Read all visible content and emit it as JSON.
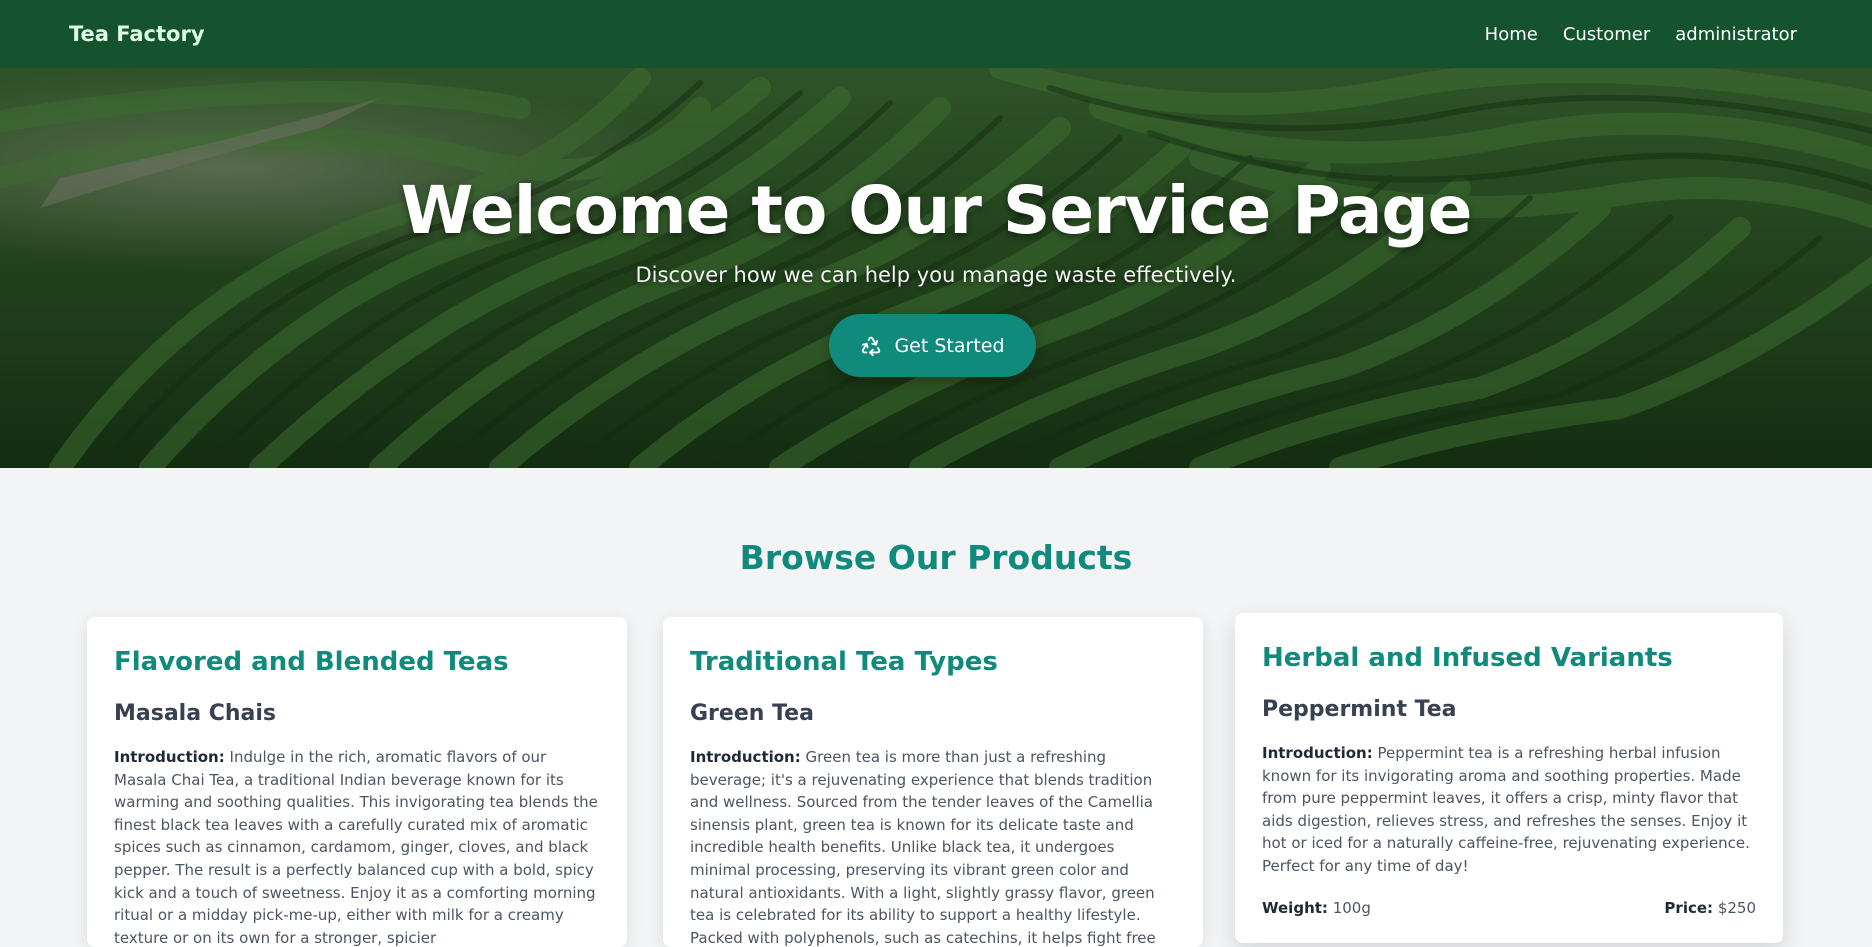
{
  "navbar": {
    "brand": "Tea Factory",
    "links": [
      "Home",
      "Customer",
      "administrator"
    ]
  },
  "hero": {
    "title": "Welcome to Our Service Page",
    "subtitle": "Discover how we can help you manage waste effectively.",
    "cta_label": "Get Started",
    "cta_icon": "recycle-icon"
  },
  "products": {
    "section_title": "Browse Our Products",
    "cards": [
      {
        "category": "Flavored and Blended Teas",
        "name": "Masala Chais",
        "intro_label": "Introduction:",
        "intro": "Indulge in the rich, aromatic flavors of our Masala Chai Tea, a traditional Indian beverage known for its warming and soothing qualities. This invigorating tea blends the finest black tea leaves with a carefully curated mix of aromatic spices such as cinnamon, cardamom, ginger, cloves, and black pepper. The result is a perfectly balanced cup with a bold, spicy kick and a touch of sweetness. Enjoy it as a comforting morning ritual or a midday pick-me-up, either with milk for a creamy texture or on its own for a stronger, spicier"
      },
      {
        "category": "Traditional Tea Types",
        "name": "Green Tea",
        "intro_label": "Introduction:",
        "intro": "Green tea is more than just a refreshing beverage; it's a rejuvenating experience that blends tradition and wellness. Sourced from the tender leaves of the Camellia sinensis plant, green tea is known for its delicate taste and incredible health benefits. Unlike black tea, it undergoes minimal processing, preserving its vibrant green color and natural antioxidants. With a light, slightly grassy flavor, green tea is celebrated for its ability to support a healthy lifestyle. Packed with polyphenols, such as catechins, it helps fight free"
      },
      {
        "category": "Herbal and Infused Variants",
        "name": "Peppermint Tea",
        "intro_label": "Introduction:",
        "intro": "Peppermint tea is a refreshing herbal infusion known for its invigorating aroma and soothing properties. Made from pure peppermint leaves, it offers a crisp, minty flavor that aids digestion, relieves stress, and refreshes the senses. Enjoy it hot or iced for a naturally caffeine-free, rejuvenating experience. Perfect for any time of day!",
        "weight_label": "Weight:",
        "weight": "100g",
        "price_label": "Price:",
        "price": "$250"
      }
    ]
  },
  "colors": {
    "navbar": "#14532d",
    "accent": "#0f8a7c",
    "page_bg": "#f3f4f6"
  }
}
